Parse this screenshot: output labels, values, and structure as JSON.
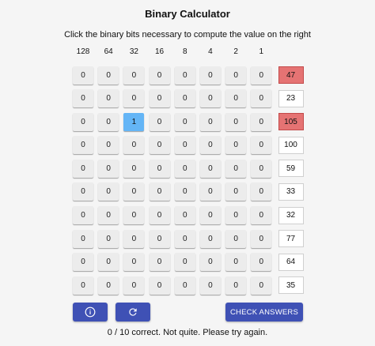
{
  "title": "Binary Calculator",
  "instructions": "Click the binary bits necessary to compute the value on the right",
  "headers": [
    "128",
    "64",
    "32",
    "16",
    "8",
    "4",
    "2",
    "1"
  ],
  "rows": [
    {
      "bits": [
        "0",
        "0",
        "0",
        "0",
        "0",
        "0",
        "0",
        "0"
      ],
      "target": "47",
      "wrong": true
    },
    {
      "bits": [
        "0",
        "0",
        "0",
        "0",
        "0",
        "0",
        "0",
        "0"
      ],
      "target": "23",
      "wrong": false
    },
    {
      "bits": [
        "0",
        "0",
        "1",
        "0",
        "0",
        "0",
        "0",
        "0"
      ],
      "target": "105",
      "wrong": true
    },
    {
      "bits": [
        "0",
        "0",
        "0",
        "0",
        "0",
        "0",
        "0",
        "0"
      ],
      "target": "100",
      "wrong": false
    },
    {
      "bits": [
        "0",
        "0",
        "0",
        "0",
        "0",
        "0",
        "0",
        "0"
      ],
      "target": "59",
      "wrong": false
    },
    {
      "bits": [
        "0",
        "0",
        "0",
        "0",
        "0",
        "0",
        "0",
        "0"
      ],
      "target": "33",
      "wrong": false
    },
    {
      "bits": [
        "0",
        "0",
        "0",
        "0",
        "0",
        "0",
        "0",
        "0"
      ],
      "target": "32",
      "wrong": false
    },
    {
      "bits": [
        "0",
        "0",
        "0",
        "0",
        "0",
        "0",
        "0",
        "0"
      ],
      "target": "77",
      "wrong": false
    },
    {
      "bits": [
        "0",
        "0",
        "0",
        "0",
        "0",
        "0",
        "0",
        "0"
      ],
      "target": "64",
      "wrong": false
    },
    {
      "bits": [
        "0",
        "0",
        "0",
        "0",
        "0",
        "0",
        "0",
        "0"
      ],
      "target": "35",
      "wrong": false
    }
  ],
  "buttons": {
    "info_icon": "info-icon",
    "reset_icon": "refresh-icon",
    "check_label": "CHECK ANSWERS"
  },
  "status": "0 / 10 correct. Not quite. Please try again.",
  "colors": {
    "accent": "#3f51b5",
    "bit_on": "#64b5f6",
    "wrong": "#e57373"
  }
}
